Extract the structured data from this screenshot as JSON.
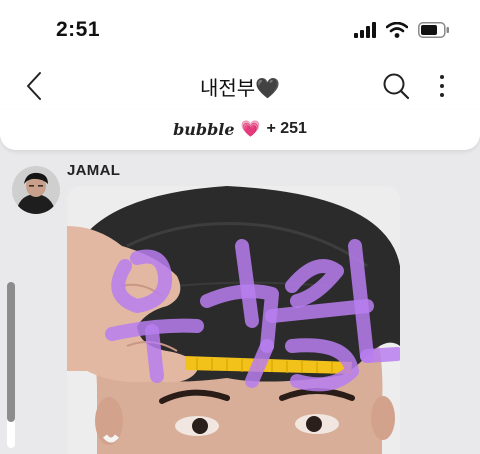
{
  "status_bar": {
    "time": "2:51",
    "icons": [
      "cellular-signal-icon",
      "wifi-icon",
      "battery-icon"
    ]
  },
  "nav": {
    "title": "내전부🖤",
    "back_icon": "chevron-left-icon",
    "search_icon": "search-icon",
    "more_icon": "more-vertical-icon"
  },
  "bubble": {
    "brand": "bubble",
    "heart": "💗",
    "count": "+ 251"
  },
  "message": {
    "sender": "JAMAL"
  },
  "scrollbar": {
    "position": 0.15
  },
  "colors": {
    "handwriting": "#b87ef0",
    "comb": "#f2c21a",
    "hair": "#2b2b2b",
    "skin": "#d9ae98"
  }
}
